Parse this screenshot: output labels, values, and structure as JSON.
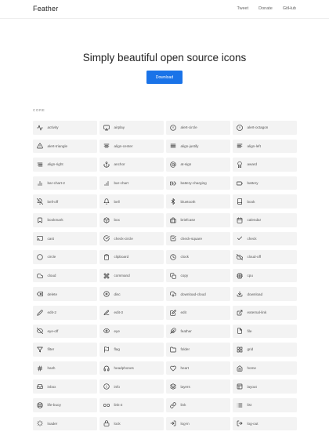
{
  "header": {
    "logo": "Feather",
    "nav": [
      "Tweet",
      "Donate",
      "GitHub"
    ]
  },
  "hero": {
    "title": "Simply beautiful open source icons",
    "download_label": "Download"
  },
  "section_label": "CORE",
  "colors": {
    "accent": "#1a73e8",
    "cell_bg": "#f3f3f3",
    "text": "#333333"
  },
  "icons": [
    "activity",
    "airplay",
    "alert-circle",
    "alert-octagon",
    "alert-triangle",
    "align-center",
    "align-justify",
    "align-left",
    "align-right",
    "anchor",
    "at-sign",
    "award",
    "bar-chart-2",
    "bar-chart",
    "battery-charging",
    "battery",
    "bell-off",
    "bell",
    "bluetooth",
    "book",
    "bookmark",
    "box",
    "briefcase",
    "calendar",
    "cast",
    "check-circle",
    "check-square",
    "check",
    "circle",
    "clipboard",
    "clock",
    "cloud-off",
    "cloud",
    "command",
    "copy",
    "cpu",
    "delete",
    "disc",
    "download-cloud",
    "download",
    "edit-2",
    "edit-3",
    "edit",
    "external-link",
    "eye-off",
    "eye",
    "feather",
    "file",
    "filter",
    "flag",
    "folder",
    "grid",
    "hash",
    "headphones",
    "heart",
    "home",
    "inbox",
    "info",
    "layers",
    "layout",
    "life-buoy",
    "link-2",
    "link",
    "list",
    "loader",
    "lock",
    "log-in",
    "log-out"
  ]
}
